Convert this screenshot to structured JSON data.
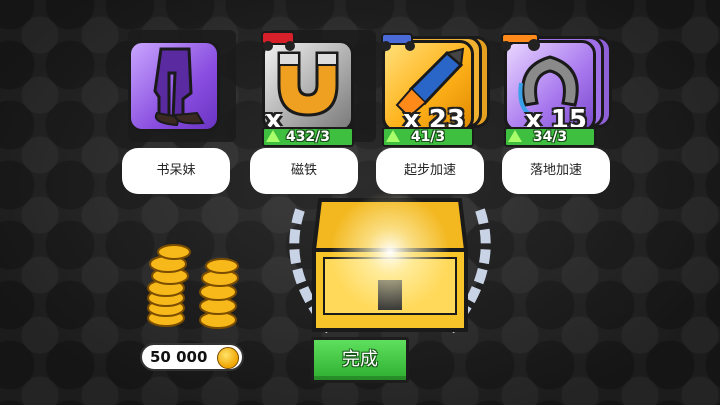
{
  "rewards": [
    {
      "name": "书呆妹",
      "icon": "pants-icon",
      "quantity": "",
      "progress": ""
    },
    {
      "name": "磁铁",
      "icon": "magnet-icon",
      "quantity": "x 135",
      "progress": "432/3"
    },
    {
      "name": "起步加速",
      "icon": "rocket-icon",
      "quantity": "x 23",
      "progress": "41/3"
    },
    {
      "name": "落地加速",
      "icon": "horseshoe-icon",
      "quantity": "x 15",
      "progress": "34/3"
    }
  ],
  "coins": {
    "amount": "50 000"
  },
  "done_button": {
    "label": "完成"
  },
  "colors": {
    "progress_green": "#3fbf3f",
    "button_green": "#4cc94c",
    "coin_gold": "#f0a400"
  }
}
